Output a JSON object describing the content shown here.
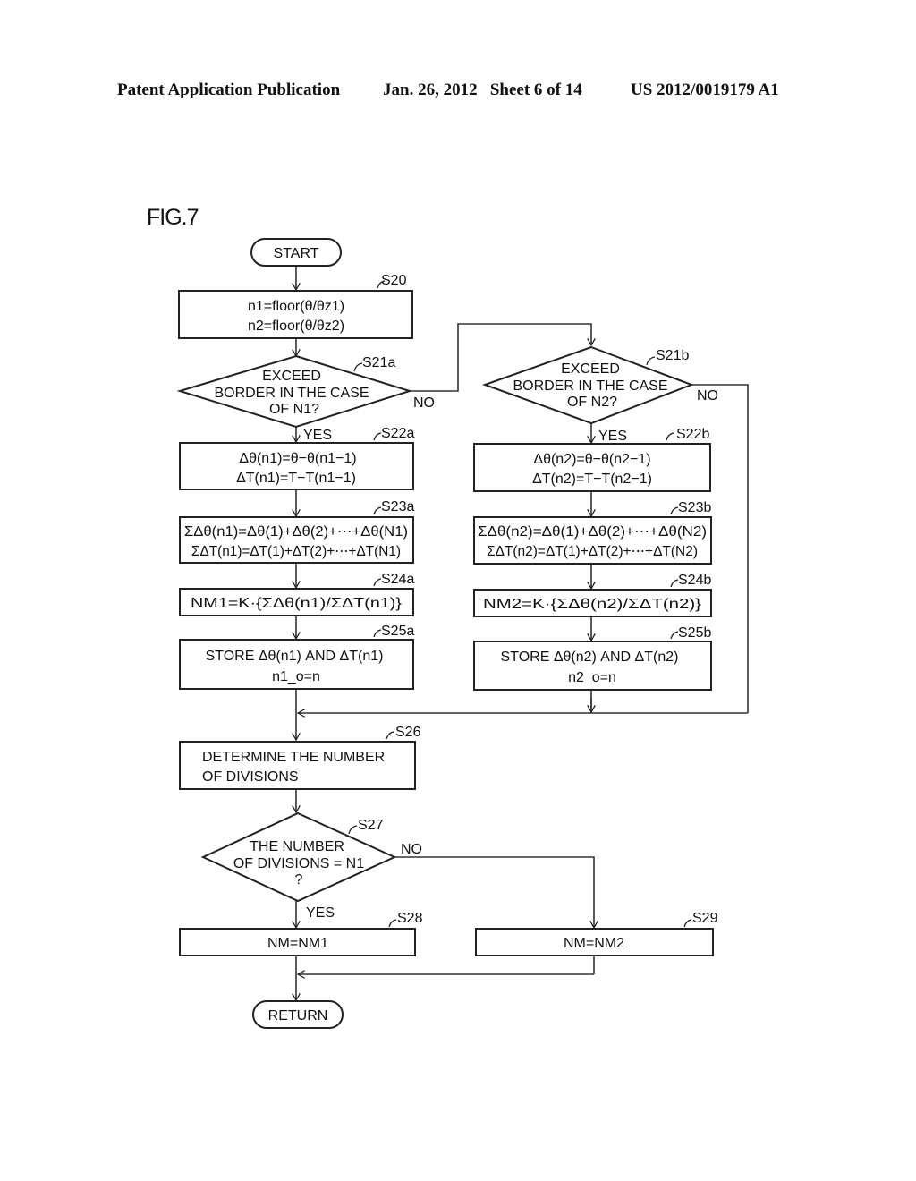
{
  "header": {
    "publication": "Patent Application Publication",
    "date_sheet": "Jan. 26, 2012   Sheet 6 of 14",
    "patent_number": "US 2012/0019179 A1"
  },
  "figure_label": "FIG.7",
  "nodes": {
    "start": {
      "text": "START"
    },
    "s20": {
      "step": "S20",
      "lines": [
        "n1=floor(θ/θz1)",
        "n2=floor(θ/θz2)"
      ]
    },
    "s21a": {
      "step": "S21a",
      "lines": [
        "EXCEED",
        "BORDER IN THE CASE",
        "OF N1?"
      ]
    },
    "s22a": {
      "step": "S22a",
      "lines": [
        "Δθ(n1)=θ−θ(n1−1)",
        "ΔT(n1)=T−T(n1−1)"
      ]
    },
    "s23a": {
      "step": "S23a",
      "lines": [
        "ΣΔθ(n1)=Δθ(1)+Δθ(2)+⋯+Δθ(N1)",
        "ΣΔT(n1)=ΔT(1)+ΔT(2)+⋯+ΔT(N1)"
      ]
    },
    "s24a": {
      "step": "S24a",
      "lines": [
        "NM1=K·{ΣΔθ(n1)/ΣΔT(n1)}"
      ]
    },
    "s25a": {
      "step": "S25a",
      "lines": [
        "STORE Δθ(n1) AND ΔT(n1)",
        "n1_o=n"
      ]
    },
    "s21b": {
      "step": "S21b",
      "lines": [
        "EXCEED",
        "BORDER IN THE CASE",
        "OF N2?"
      ]
    },
    "s22b": {
      "step": "S22b",
      "lines": [
        "Δθ(n2)=θ−θ(n2−1)",
        "ΔT(n2)=T−T(n2−1)"
      ]
    },
    "s23b": {
      "step": "S23b",
      "lines": [
        "ΣΔθ(n2)=Δθ(1)+Δθ(2)+⋯+Δθ(N2)",
        "ΣΔT(n2)=ΔT(1)+ΔT(2)+⋯+ΔT(N2)"
      ]
    },
    "s24b": {
      "step": "S24b",
      "lines": [
        "NM2=K·{ΣΔθ(n2)/ΣΔT(n2)}"
      ]
    },
    "s25b": {
      "step": "S25b",
      "lines": [
        "STORE Δθ(n2) AND ΔT(n2)",
        "n2_o=n"
      ]
    },
    "s26": {
      "step": "S26",
      "lines": [
        "DETERMINE THE NUMBER",
        "OF DIVISIONS"
      ]
    },
    "s27": {
      "step": "S27",
      "lines": [
        "THE NUMBER",
        "OF DIVISIONS = N1",
        "?"
      ]
    },
    "s28": {
      "step": "S28",
      "lines": [
        "NM=NM1"
      ]
    },
    "s29": {
      "step": "S29",
      "lines": [
        "NM=NM2"
      ]
    },
    "return": {
      "text": "RETURN"
    }
  },
  "edge_labels": {
    "s21a_yes": "YES",
    "s21a_no": "NO",
    "s21b_yes": "YES",
    "s21b_no": "NO",
    "s27_yes": "YES",
    "s27_no": "NO"
  }
}
